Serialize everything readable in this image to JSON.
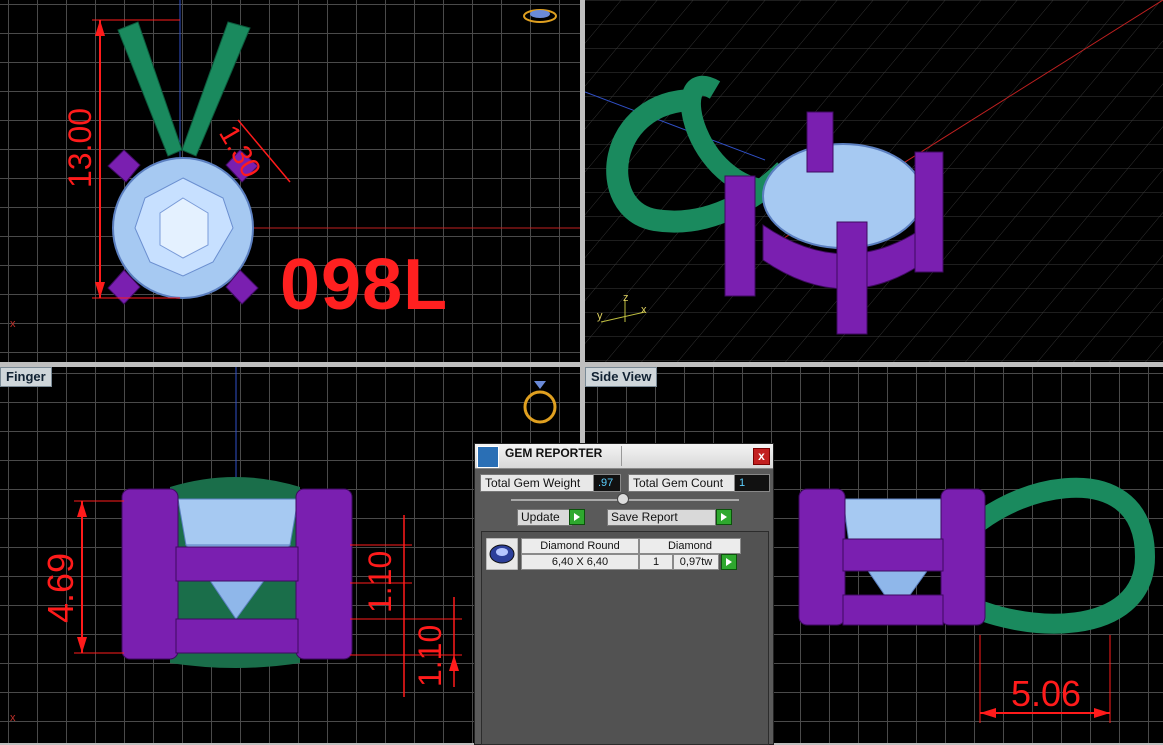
{
  "viewports": {
    "top_left": {
      "label": "",
      "mark": "098L",
      "dims": [
        "13.00",
        "1.30"
      ]
    },
    "top_right": {
      "label": ""
    },
    "bottom_left": {
      "label": "Finger",
      "dims": [
        "4.69",
        "1.10",
        "1.10"
      ]
    },
    "bottom_right": {
      "label": "Side View",
      "dims": [
        "5.06"
      ]
    }
  },
  "axis_labels": {
    "x": "x",
    "y": "y",
    "z": "z"
  },
  "gem_reporter": {
    "title": "GEM REPORTER",
    "close": "x",
    "total_weight_label": "Total Gem Weight",
    "total_weight_value": ".97",
    "total_count_label": "Total Gem Count",
    "total_count_value": "1",
    "update_label": "Update",
    "save_report_label": "Save Report",
    "rows": [
      {
        "shape": "Diamond Round",
        "size": "6,40 X 6,40",
        "material": "Diamond",
        "count": "1",
        "weight": "0,97tw"
      }
    ]
  },
  "colors": {
    "prong": "#7a1fb0",
    "bail": "#1a8a5e",
    "gem": "#9ec6f5",
    "dimension": "#ff1b1b"
  }
}
